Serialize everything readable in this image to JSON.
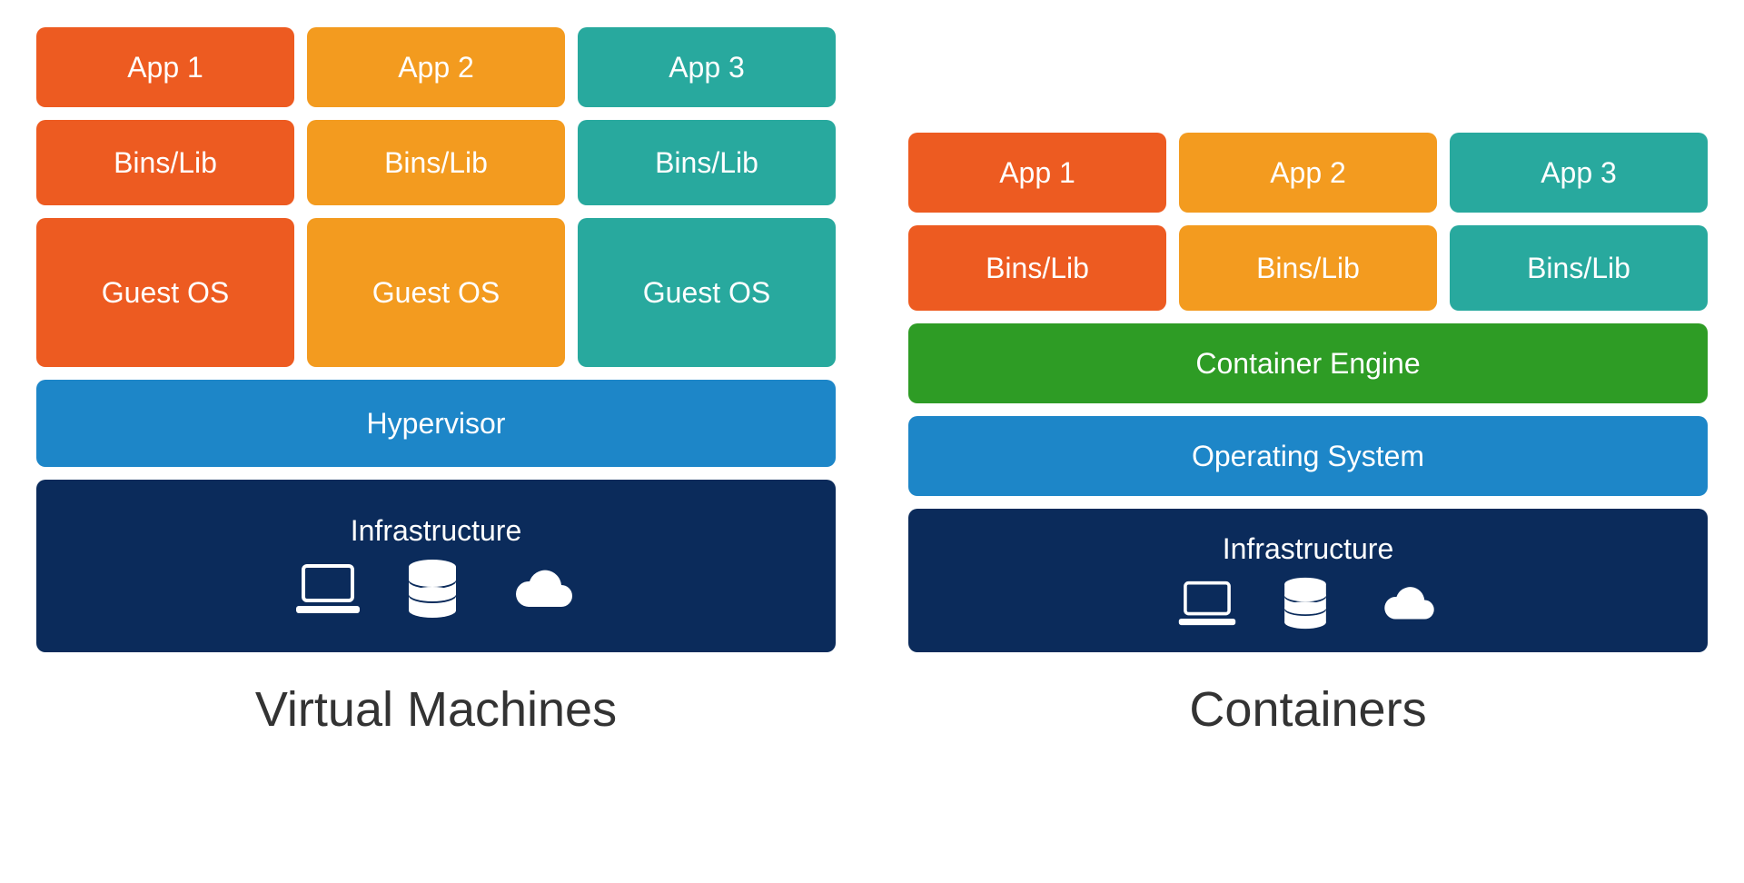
{
  "colors": {
    "orange1": "#ED5B21",
    "orange2": "#F39B1F",
    "teal": "#28A99E",
    "green": "#2E9C25",
    "blue": "#1D86C8",
    "navy": "#0B2B5B"
  },
  "vm": {
    "title": "Virtual Machines",
    "columns": [
      {
        "app": "App 1",
        "libs": "Bins/Lib",
        "os": "Guest OS",
        "color": "orange1"
      },
      {
        "app": "App 2",
        "libs": "Bins/Lib",
        "os": "Guest OS",
        "color": "orange2"
      },
      {
        "app": "App 3",
        "libs": "Bins/Lib",
        "os": "Guest OS",
        "color": "teal"
      }
    ],
    "hypervisor": "Hypervisor",
    "infrastructure": "Infrastructure"
  },
  "containers": {
    "title": "Containers",
    "columns": [
      {
        "app": "App 1",
        "libs": "Bins/Lib",
        "color": "orange1"
      },
      {
        "app": "App 2",
        "libs": "Bins/Lib",
        "color": "orange2"
      },
      {
        "app": "App 3",
        "libs": "Bins/Lib",
        "color": "teal"
      }
    ],
    "engine": "Container Engine",
    "os": "Operating System",
    "infrastructure": "Infrastructure"
  },
  "icons": [
    "laptop",
    "database",
    "cloud"
  ]
}
